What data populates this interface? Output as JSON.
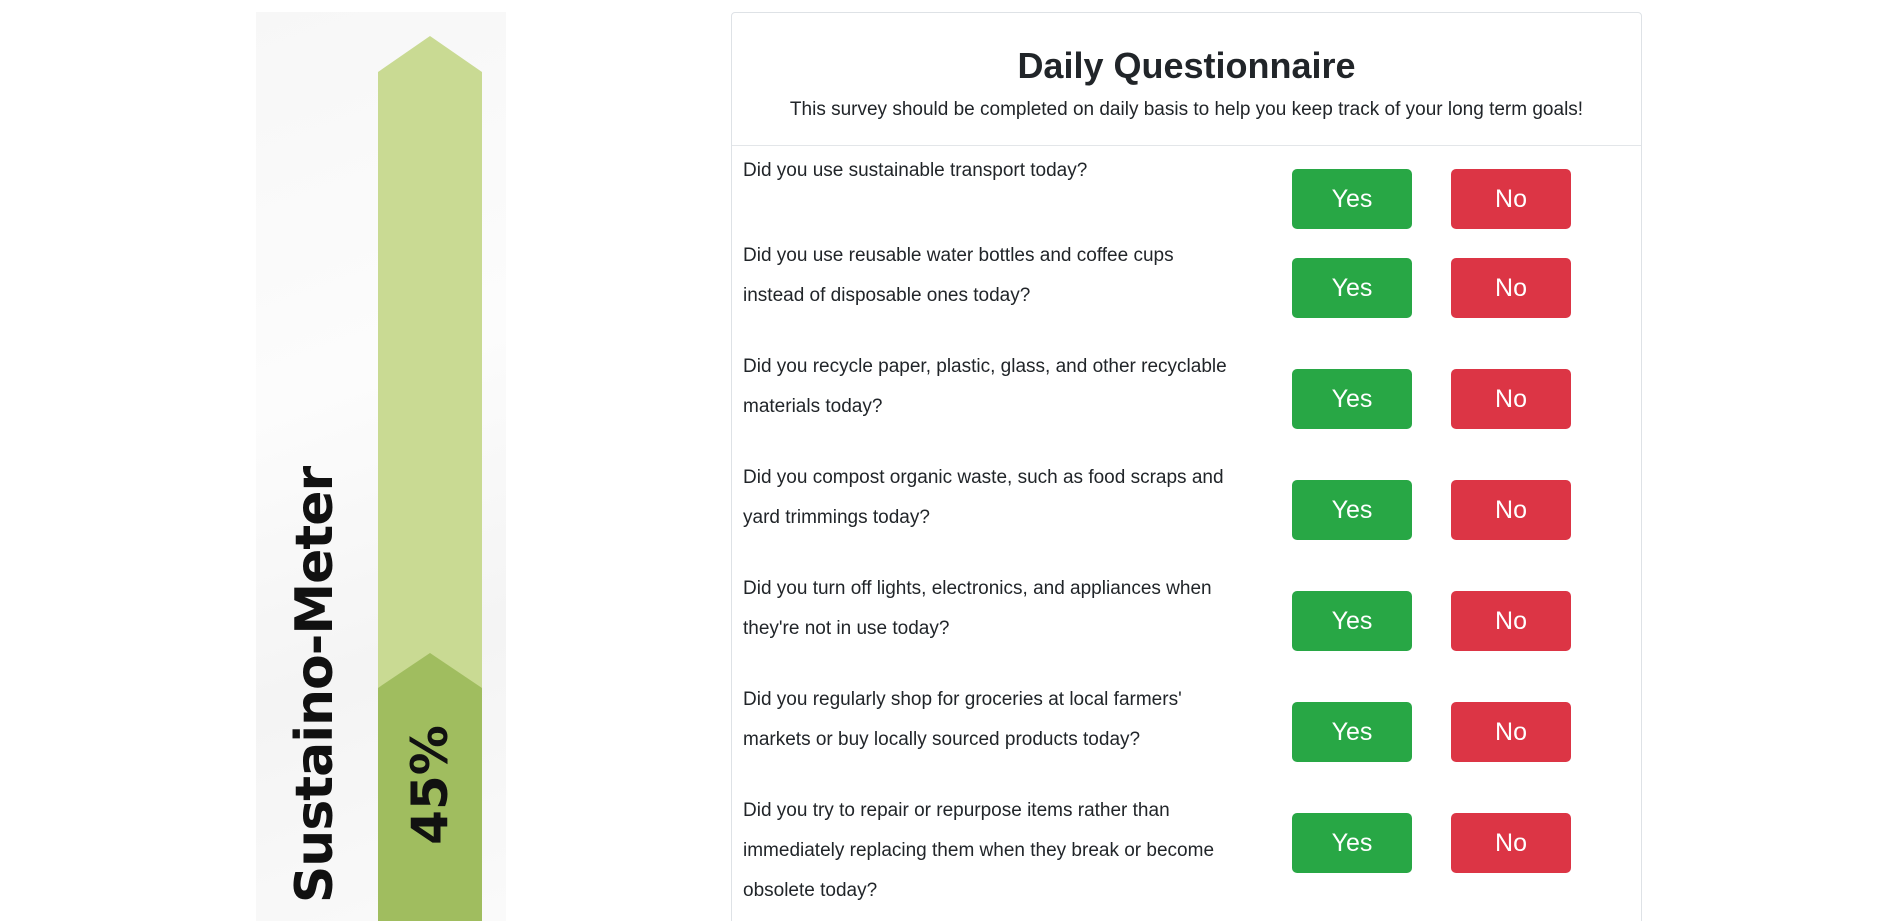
{
  "meter": {
    "title": "Sustaino-Meter",
    "value_label": "45%",
    "level": 0.45,
    "colors": {
      "track": "#c9da93",
      "fill": "#a0bd5f"
    }
  },
  "questionnaire": {
    "title": "Daily Questionnaire",
    "subtitle": "This survey should be completed on daily basis to help you keep track of your long term goals!",
    "yes_label": "Yes",
    "no_label": "No",
    "colors": {
      "yes": "#28a745",
      "no": "#dc3545"
    },
    "questions": [
      {
        "lines": [
          "Did you use sustainable transport today?"
        ]
      },
      {
        "lines": [
          "Did you use reusable water bottles and coffee cups",
          "instead of disposable ones today?"
        ]
      },
      {
        "lines": [
          "Did you recycle paper, plastic, glass, and other recyclable",
          "materials today?"
        ]
      },
      {
        "lines": [
          "Did you compost organic waste, such as food scraps and",
          "yard trimmings today?"
        ]
      },
      {
        "lines": [
          "Did you turn off lights, electronics, and appliances when",
          "they're not in use today?"
        ]
      },
      {
        "lines": [
          "Did you regularly shop for groceries at local farmers'",
          "markets or buy locally sourced products today?"
        ]
      },
      {
        "lines": [
          "Did you try to repair or repurpose items rather than",
          "immediately replacing them when they break or become",
          "obsolete today?"
        ]
      }
    ]
  }
}
